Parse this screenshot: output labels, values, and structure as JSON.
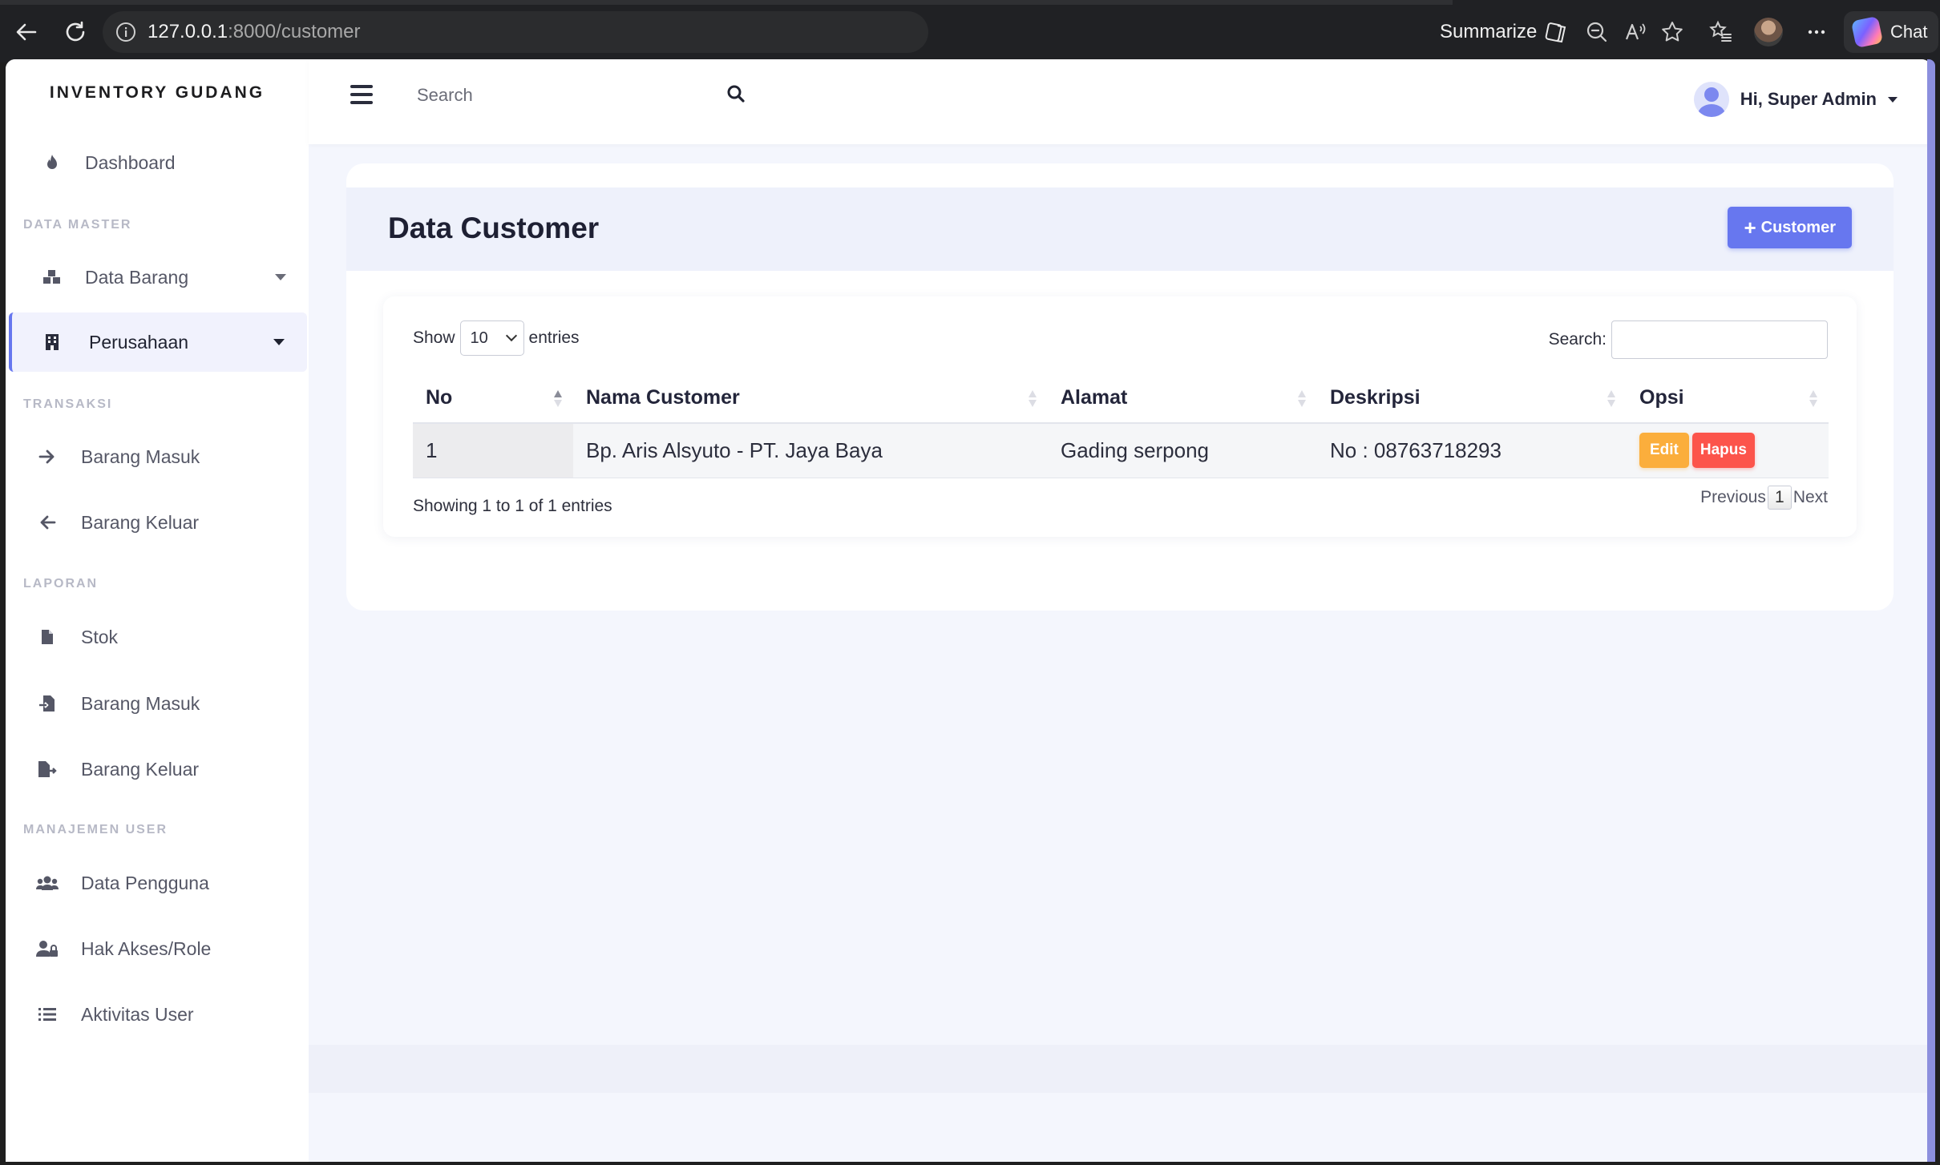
{
  "browser": {
    "url_host": "127.0.0.1",
    "url_path": ":8000/customer",
    "summarize_label": "Summarize",
    "chat_label": "Chat"
  },
  "sidebar": {
    "brand": "INVENTORY GUDANG",
    "dashboard": "Dashboard",
    "sections": {
      "master": "DATA MASTER",
      "transaksi": "TRANSAKSI",
      "laporan": "LAPORAN",
      "user": "MANAJEMEN USER"
    },
    "items": {
      "data_barang": "Data Barang",
      "perusahaan": "Perusahaan",
      "barang_masuk": "Barang Masuk",
      "barang_keluar": "Barang Keluar",
      "stok": "Stok",
      "lap_barang_masuk": "Barang Masuk",
      "lap_barang_keluar": "Barang Keluar",
      "data_pengguna": "Data Pengguna",
      "hak_akses": "Hak Akses/Role",
      "aktivitas": "Aktivitas User"
    }
  },
  "topbar": {
    "search_placeholder": "Search",
    "user_greeting": "Hi, Super Admin"
  },
  "page": {
    "title": "Data Customer",
    "add_button": "Customer"
  },
  "table": {
    "show_label": "Show",
    "entries_label": "entries",
    "page_length": "10",
    "search_label": "Search:",
    "columns": [
      "No",
      "Nama Customer",
      "Alamat",
      "Deskripsi",
      "Opsi"
    ],
    "rows": [
      {
        "no": "1",
        "nama": "Bp. Aris Alsyuto - PT. Jaya Baya",
        "alamat": "Gading serpong",
        "deskripsi": "No : 08763718293"
      }
    ],
    "edit_label": "Edit",
    "delete_label": "Hapus",
    "info": "Showing 1 to 1 of 1 entries",
    "previous": "Previous",
    "current_page": "1",
    "next": "Next"
  },
  "colors": {
    "primary": "#6777ef",
    "warning": "#fbae3c",
    "danger": "#fc544b"
  },
  "icons": {
    "dashboard": "fire-icon",
    "data_barang": "cubes-icon",
    "perusahaan": "building-icon",
    "barang_masuk": "arrow-right-icon",
    "barang_keluar": "arrow-left-icon",
    "stok": "file-icon",
    "lap_masuk": "file-import-icon",
    "lap_keluar": "file-export-icon",
    "pengguna": "users-icon",
    "hak_akses": "user-lock-icon",
    "aktivitas": "list-icon"
  }
}
